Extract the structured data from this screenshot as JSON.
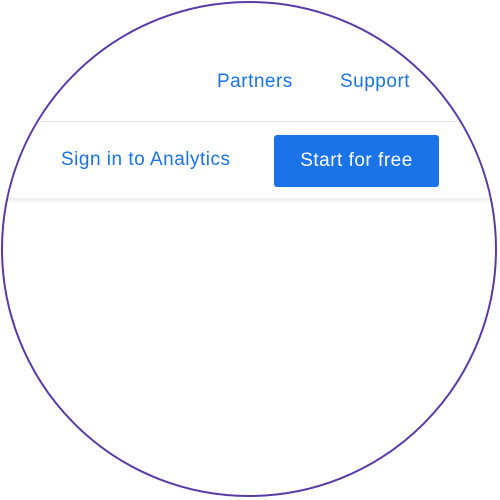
{
  "top_nav": {
    "partners_label": "Partners",
    "support_label": "Support"
  },
  "action_bar": {
    "sign_in_label": "Sign in to Analytics",
    "start_label": "Start for free"
  },
  "colors": {
    "accent": "#1a73e8",
    "lens_border": "#5b3aa8"
  }
}
